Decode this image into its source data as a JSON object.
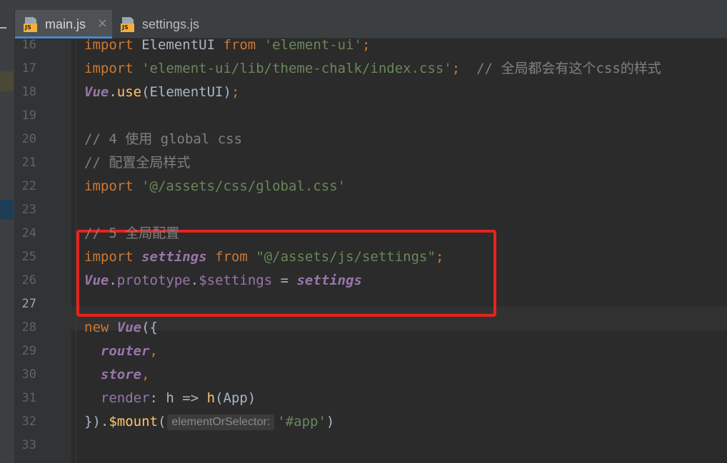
{
  "tabs": [
    {
      "label": "main.js",
      "icon": "js-file-icon",
      "active": true,
      "closable": true
    },
    {
      "label": "settings.js",
      "icon": "js-file-icon",
      "active": false,
      "closable": false
    }
  ],
  "icon_badge": "JS",
  "close_glyph": "×",
  "current_line": 27,
  "lines": [
    {
      "n": "16",
      "t": [
        [
          "kw",
          "import"
        ],
        [
          "p",
          " ElementUI "
        ],
        [
          "kw",
          "from"
        ],
        [
          "p",
          " "
        ],
        [
          "str",
          "'element-ui'"
        ],
        [
          "kw",
          ";"
        ]
      ]
    },
    {
      "n": "17",
      "t": [
        [
          "kw",
          "import"
        ],
        [
          "p",
          " "
        ],
        [
          "str",
          "'element-ui/lib/theme-chalk/index.css'"
        ],
        [
          "kw",
          ";"
        ],
        [
          "p",
          "  "
        ],
        [
          "cm",
          "// 全局都会有这个css的样式"
        ]
      ]
    },
    {
      "n": "18",
      "t": [
        [
          "cls",
          "Vue"
        ],
        [
          "p",
          "."
        ],
        [
          "fn",
          "use"
        ],
        [
          "p",
          "(ElementUI)"
        ],
        [
          "kw",
          ";"
        ]
      ]
    },
    {
      "n": "19",
      "t": []
    },
    {
      "n": "20",
      "t": [
        [
          "cm",
          "// 4 使用 global css"
        ]
      ]
    },
    {
      "n": "21",
      "t": [
        [
          "cm",
          "// 配置全局样式"
        ]
      ]
    },
    {
      "n": "22",
      "t": [
        [
          "kw",
          "import"
        ],
        [
          "p",
          " "
        ],
        [
          "str",
          "'@/assets/css/global.css'"
        ]
      ]
    },
    {
      "n": "23",
      "t": []
    },
    {
      "n": "24",
      "t": [
        [
          "cm",
          "// 5 全局配置"
        ]
      ]
    },
    {
      "n": "25",
      "t": [
        [
          "kw",
          "import"
        ],
        [
          "p",
          " "
        ],
        [
          "fld",
          "settings"
        ],
        [
          "p",
          " "
        ],
        [
          "kw",
          "from"
        ],
        [
          "p",
          " "
        ],
        [
          "str",
          "\"@/assets/js/settings\""
        ],
        [
          "kw",
          ";"
        ]
      ]
    },
    {
      "n": "26",
      "t": [
        [
          "cls",
          "Vue"
        ],
        [
          "p",
          "."
        ],
        [
          "prop",
          "prototype"
        ],
        [
          "p",
          "."
        ],
        [
          "prop",
          "$settings"
        ],
        [
          "p",
          " = "
        ],
        [
          "fld",
          "settings"
        ]
      ]
    },
    {
      "n": "27",
      "t": []
    },
    {
      "n": "28",
      "t": [
        [
          "kw",
          "new"
        ],
        [
          "p",
          " "
        ],
        [
          "cls",
          "Vue"
        ],
        [
          "p",
          "({"
        ]
      ]
    },
    {
      "n": "29",
      "t": [
        [
          "p",
          "  "
        ],
        [
          "fld",
          "router"
        ],
        [
          "kw",
          ","
        ]
      ]
    },
    {
      "n": "30",
      "t": [
        [
          "p",
          "  "
        ],
        [
          "fld",
          "store"
        ],
        [
          "kw",
          ","
        ]
      ]
    },
    {
      "n": "31",
      "t": [
        [
          "p",
          "  "
        ],
        [
          "prop",
          "render"
        ],
        [
          "p",
          ": h => "
        ],
        [
          "fn",
          "h"
        ],
        [
          "p",
          "(App)"
        ]
      ]
    },
    {
      "n": "32",
      "t": [
        [
          "p",
          "})."
        ],
        [
          "fn",
          "$mount"
        ],
        [
          "p",
          "("
        ],
        [
          "hint",
          "elementOrSelector:"
        ],
        [
          "str",
          "'#app'"
        ],
        [
          "p",
          ")"
        ]
      ]
    },
    {
      "n": "33",
      "t": []
    }
  ],
  "folds": [
    "16",
    "17",
    "20",
    "21",
    "28",
    "32"
  ],
  "colors": {
    "keyword": "#cc7832",
    "string": "#6a8759",
    "comment": "#808080",
    "class": "#9876aa",
    "function": "#ffc66d",
    "highlight_box": "#e8231c"
  }
}
